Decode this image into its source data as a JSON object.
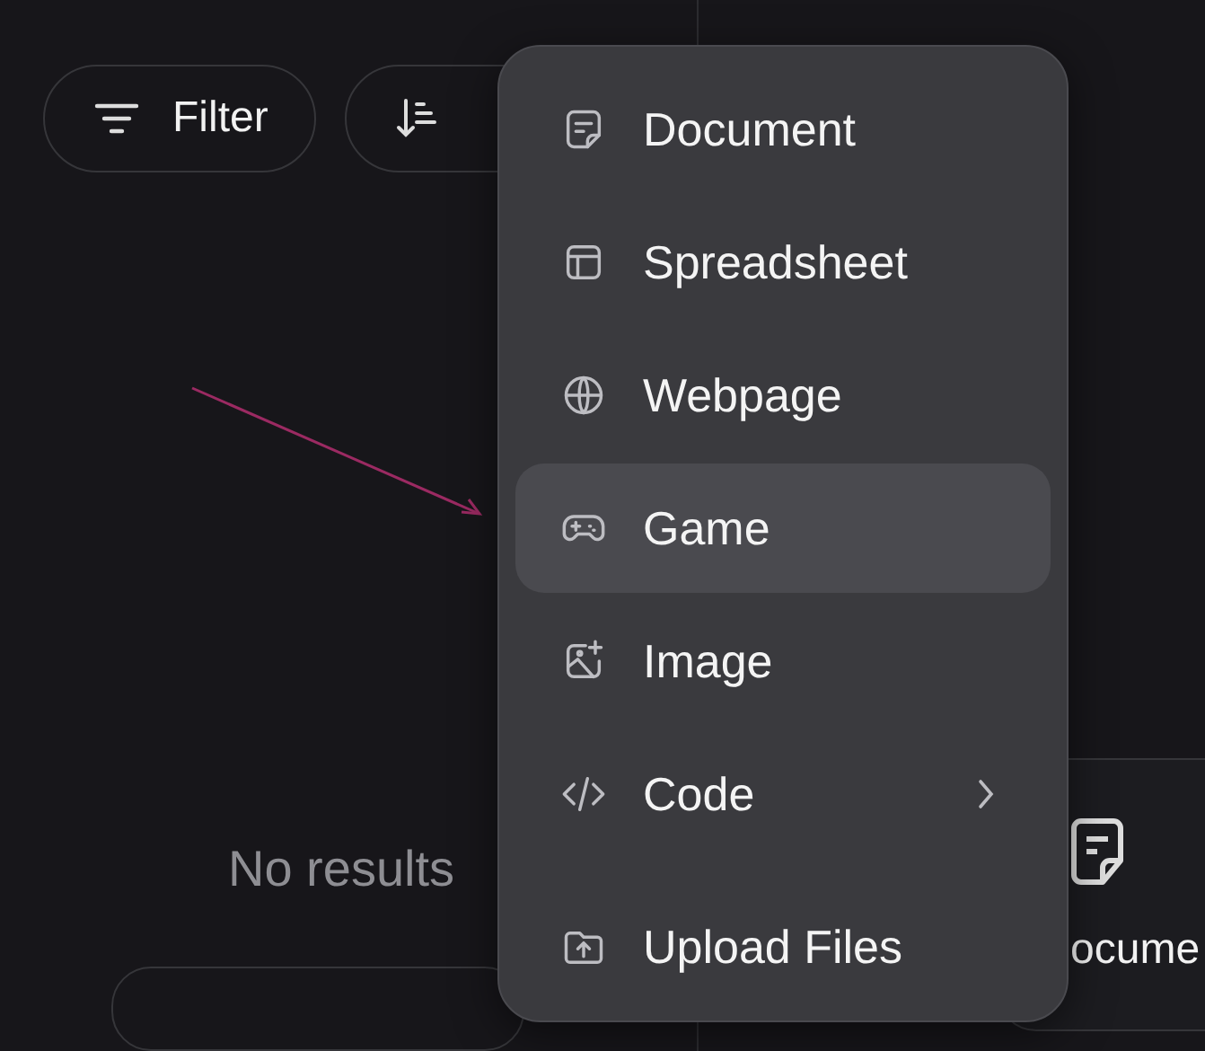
{
  "toolbar": {
    "filter_button": {
      "label": "Filter"
    }
  },
  "empty_state": {
    "message": "No results"
  },
  "background_card": {
    "label": "ocume"
  },
  "menu": {
    "groups": [
      [
        {
          "label": "Document",
          "selected": false,
          "has_submenu": false
        },
        {
          "label": "Spreadsheet",
          "selected": false,
          "has_submenu": false
        },
        {
          "label": "Webpage",
          "selected": false,
          "has_submenu": false
        },
        {
          "label": "Game",
          "selected": true,
          "has_submenu": false
        },
        {
          "label": "Image",
          "selected": false,
          "has_submenu": false
        },
        {
          "label": "Code",
          "selected": false,
          "has_submenu": true
        }
      ],
      [
        {
          "label": "Upload Files",
          "selected": false,
          "has_submenu": false
        }
      ]
    ]
  }
}
